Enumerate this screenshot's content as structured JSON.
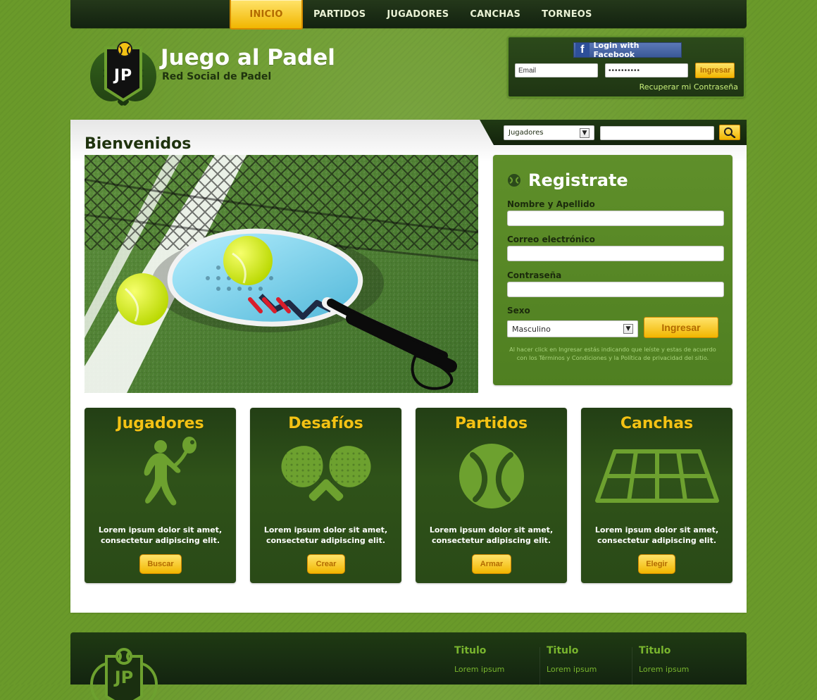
{
  "nav": {
    "items": [
      {
        "label": "INICIO",
        "active": true
      },
      {
        "label": "PARTIDOS",
        "active": false
      },
      {
        "label": "JUGADORES",
        "active": false
      },
      {
        "label": "CANCHAS",
        "active": false
      },
      {
        "label": "TORNEOS",
        "active": false
      }
    ]
  },
  "logo": {
    "badge_text": "JP",
    "title": "Juego al Padel",
    "subtitle": "Red Social de Padel"
  },
  "login": {
    "facebook_label": "Login with Facebook",
    "email_value": "Email",
    "password_value": "••••••••••",
    "submit_label": "Ingresar",
    "recover_link": "Recuperar mi Contraseña"
  },
  "search": {
    "category_value": "Jugadores",
    "query_value": ""
  },
  "main": {
    "welcome_title": "Bienvenidos"
  },
  "register": {
    "title": "Registrate",
    "fields": [
      {
        "label": "Nombre y Apellido",
        "value": ""
      },
      {
        "label": "Correo electrónico",
        "value": ""
      },
      {
        "label": "Contraseña",
        "value": ""
      }
    ],
    "sex_label": "Sexo",
    "sex_value": "Masculino",
    "submit_label": "Ingresar",
    "legal_text": "Al hacer click en Ingresar estás indicando que leíste y estas de acuerdo con los Términos y Condiciones y la Política de privacidad del sitio."
  },
  "features": [
    {
      "title": "Jugadores",
      "text": "Lorem ipsum dolor sit amet, consectetur adipiscing elit.",
      "button": "Buscar",
      "icon": "player-silhouette-icon"
    },
    {
      "title": "Desafíos",
      "text": "Lorem ipsum dolor sit amet, consectetur adipiscing elit.",
      "button": "Crear",
      "icon": "crossed-paddles-icon"
    },
    {
      "title": "Partidos",
      "text": "Lorem ipsum dolor sit amet, consectetur adipiscing elit.",
      "button": "Armar",
      "icon": "tennis-ball-icon"
    },
    {
      "title": "Canchas",
      "text": "Lorem ipsum dolor sit amet, consectetur adipiscing elit.",
      "button": "Elegir",
      "icon": "court-icon"
    }
  ],
  "footer": {
    "badge_text": "JP",
    "columns": [
      {
        "title": "Titulo",
        "link": "Lorem ipsum"
      },
      {
        "title": "Titulo",
        "link": "Lorem ipsum"
      },
      {
        "title": "Titulo",
        "link": "Lorem ipsum"
      }
    ]
  },
  "colors": {
    "page_green": "#6a9a2a",
    "dark_green": "#1f3a13",
    "accent_yellow": "#f1b600",
    "title_yellow": "#f3c214"
  }
}
